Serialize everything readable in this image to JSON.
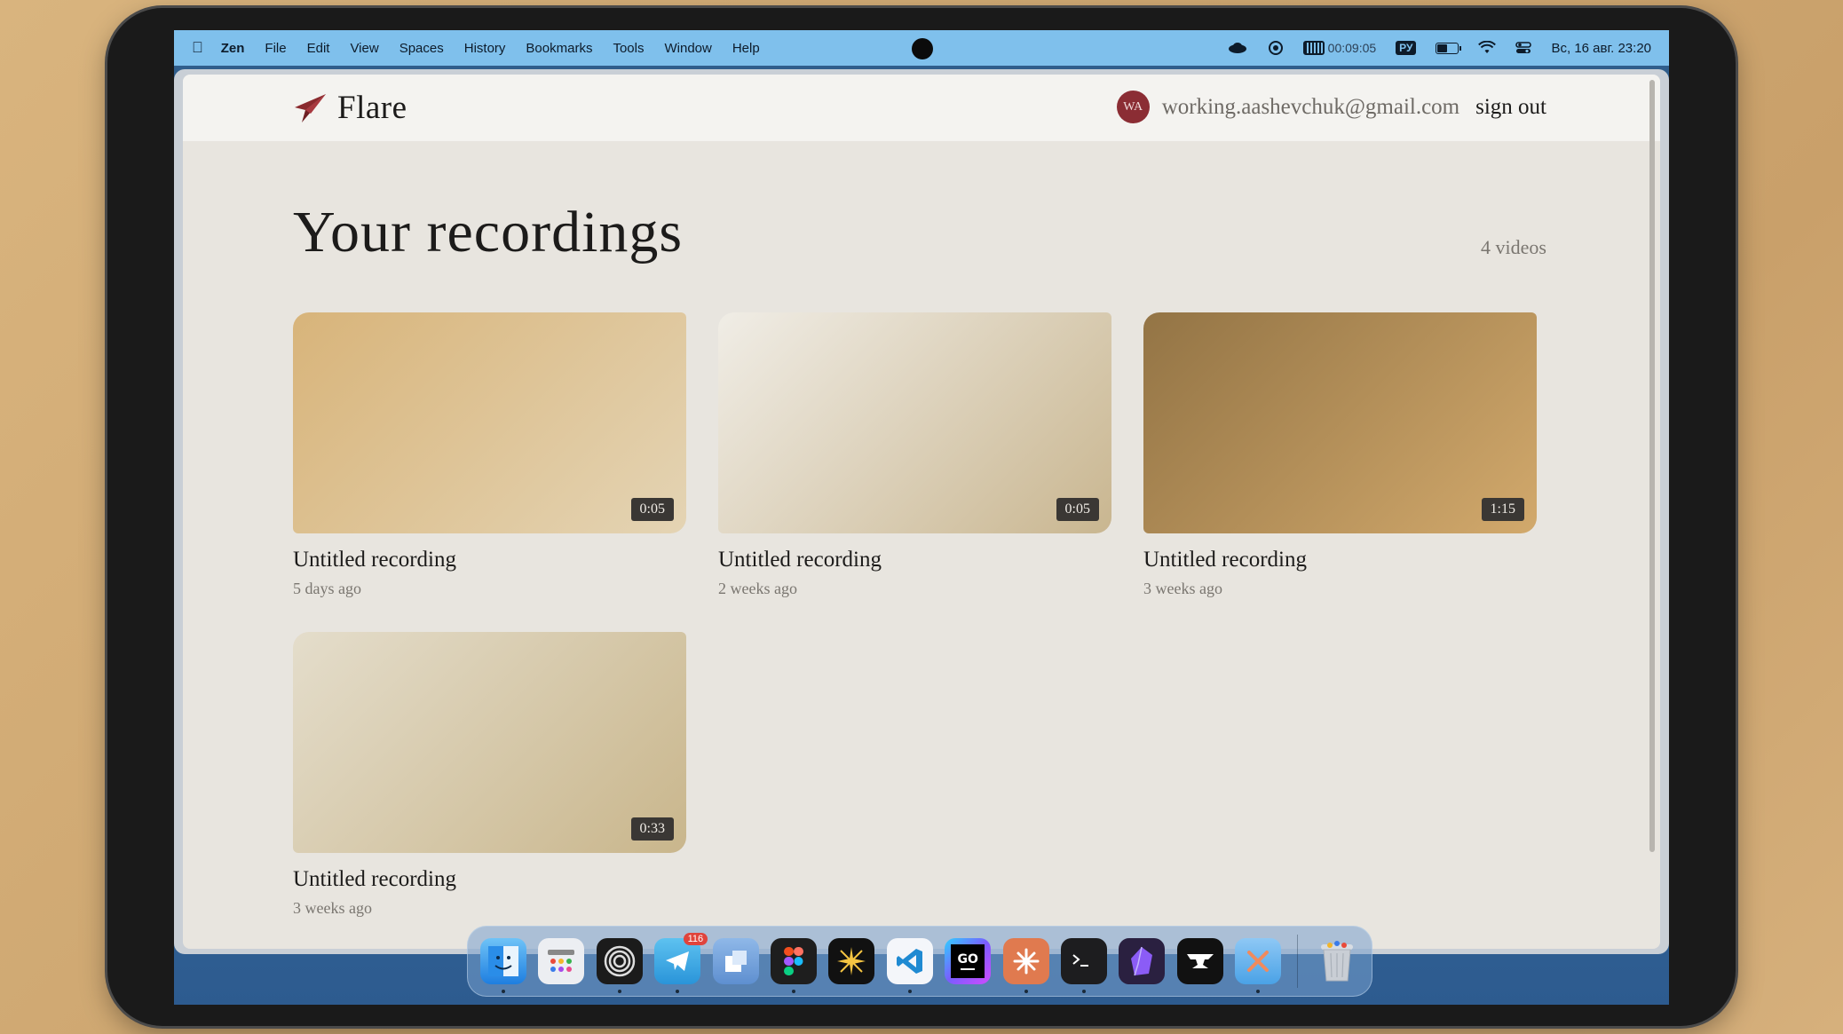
{
  "menubar": {
    "app_name": "Zen",
    "items": [
      "File",
      "Edit",
      "View",
      "Spaces",
      "History",
      "Bookmarks",
      "Tools",
      "Window",
      "Help"
    ],
    "timer": "00:09:05",
    "input_source": "РУ",
    "datetime": "Вс, 16 авг.  23:20"
  },
  "site": {
    "brand": "Flare",
    "user_initials": "WA",
    "user_email": "working.aashevchuk@gmail.com",
    "sign_out": "sign out"
  },
  "main": {
    "heading": "Your recordings",
    "count": "4 videos"
  },
  "recordings": [
    {
      "title": "Untitled recording",
      "date": "5 days ago",
      "duration": "0:05",
      "gradient": [
        "#d8b47a",
        "#e4d4b4"
      ]
    },
    {
      "title": "Untitled recording",
      "date": "2 weeks ago",
      "duration": "0:05",
      "gradient": [
        "#f0ede6",
        "#c9b690"
      ]
    },
    {
      "title": "Untitled recording",
      "date": "3 weeks ago",
      "duration": "1:15",
      "gradient": [
        "#937445",
        "#d2a96c"
      ]
    },
    {
      "title": "Untitled recording",
      "date": "3 weeks ago",
      "duration": "0:33",
      "gradient": [
        "#e4ddcb",
        "#c9b68c"
      ]
    }
  ],
  "dock": {
    "telegram_badge": "116",
    "apps": [
      "finder-icon",
      "launchpad-icon",
      "arc-icon",
      "telegram-icon",
      "screens-icon",
      "figma-icon",
      "spark-icon",
      "vscode-icon",
      "goland-icon",
      "claude-icon",
      "terminal-icon",
      "obsidian-icon",
      "anvil-icon",
      "xcode-icon",
      "trash-icon"
    ],
    "goland_label": "GO"
  }
}
